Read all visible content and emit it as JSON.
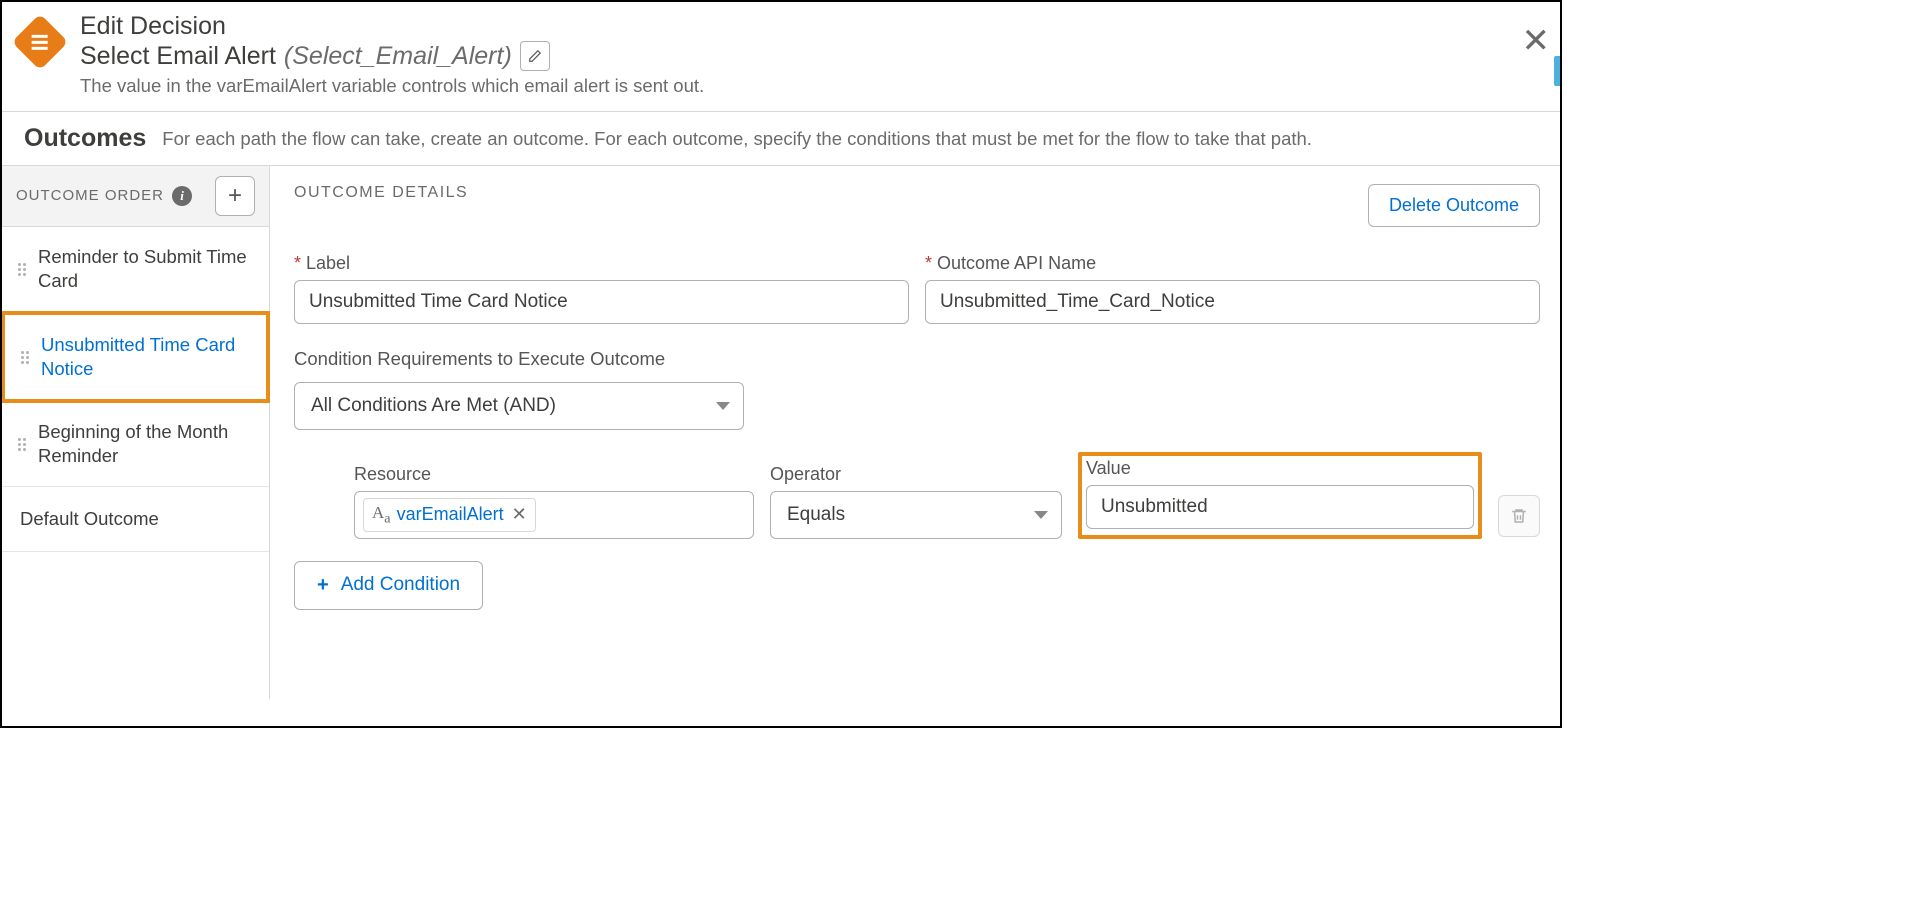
{
  "header": {
    "title": "Edit Decision",
    "subtitle_name": "Select Email Alert",
    "subtitle_api": "(Select_Email_Alert)",
    "description": "The value in the varEmailAlert variable controls which email alert is sent out."
  },
  "outcomes_section": {
    "title": "Outcomes",
    "description": "For each path the flow can take, create an outcome. For each outcome, specify the conditions that must be met for the flow to take that path."
  },
  "sidebar": {
    "order_title": "OUTCOME ORDER",
    "items": [
      {
        "label": "Reminder to Submit Time Card"
      },
      {
        "label": "Unsubmitted Time Card Notice"
      },
      {
        "label": "Beginning of the Month Reminder"
      }
    ],
    "default_label": "Default Outcome"
  },
  "details": {
    "heading": "OUTCOME DETAILS",
    "delete_label": "Delete Outcome",
    "label_field": "Label",
    "label_value": "Unsubmitted Time Card Notice",
    "api_field": "Outcome API Name",
    "api_value": "Unsubmitted_Time_Card_Notice",
    "cond_req_label": "Condition Requirements to Execute Outcome",
    "cond_req_value": "All Conditions Are Met (AND)",
    "resource_label": "Resource",
    "resource_value": "varEmailAlert",
    "operator_label": "Operator",
    "operator_value": "Equals",
    "value_label": "Value",
    "value_value": "Unsubmitted",
    "add_cond": "Add Condition"
  }
}
